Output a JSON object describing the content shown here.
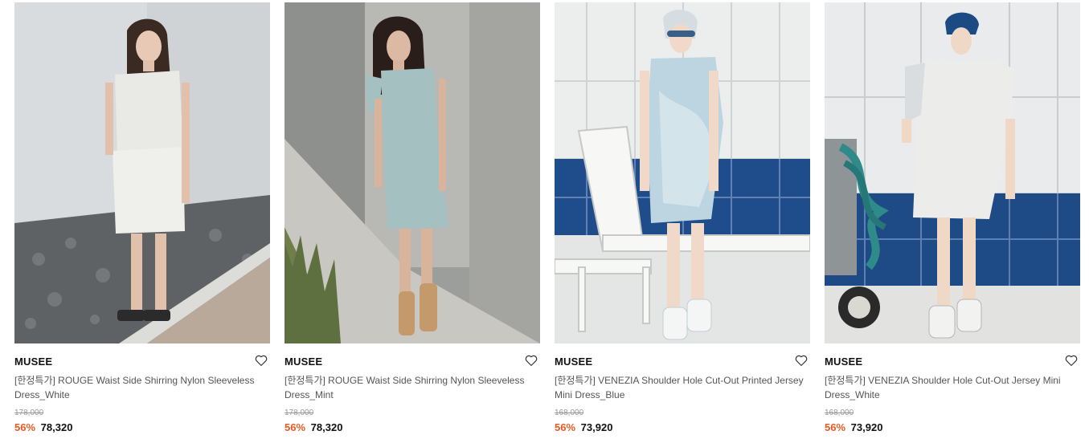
{
  "products": [
    {
      "brand": "MUSEE",
      "title": "[한정특가] ROUGE Waist Side Shirring Nylon Sleeveless Dress_White",
      "original_price": "178,000",
      "discount": "56%",
      "price": "78,320",
      "image_alt": "Model wearing white sleeveless shirring dress"
    },
    {
      "brand": "MUSEE",
      "title": "[한정특가] ROUGE Waist Side Shirring Nylon Sleeveless Dress_Mint",
      "original_price": "178,000",
      "discount": "56%",
      "price": "78,320",
      "image_alt": "Model wearing mint sleeveless shirring dress"
    },
    {
      "brand": "MUSEE",
      "title": "[한정특가] VENEZIA Shoulder Hole Cut-Out Printed Jersey Mini Dress_Blue",
      "original_price": "168,000",
      "discount": "56%",
      "price": "73,920",
      "image_alt": "Model wearing blue printed jersey mini dress by pool chairs"
    },
    {
      "brand": "MUSEE",
      "title": "[한정특가] VENEZIA Shoulder Hole Cut-Out Jersey Mini Dress_White",
      "original_price": "168,000",
      "discount": "56%",
      "price": "73,920",
      "image_alt": "Model wearing white jersey mini dress with hose cart"
    }
  ],
  "icons": {
    "wishlist": "heart-outline-icon"
  },
  "colors": {
    "discount": "#e85a23",
    "brand_text": "#111111",
    "title_text": "#555555",
    "original_price": "#999999"
  }
}
